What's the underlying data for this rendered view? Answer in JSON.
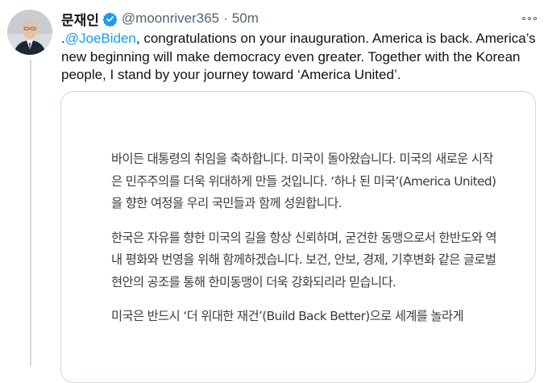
{
  "tweet": {
    "author_name": "문재인",
    "handle": "@moonriver365",
    "separator": "·",
    "time": "50m",
    "text_prefix": ".",
    "mention": "@JoeBiden",
    "text_body": ", congratulations on your inauguration. America is back. America’s new beginning will make democracy even greater. Together with the Korean people, I stand by your journey toward ‘America United’."
  },
  "card": {
    "paragraphs": [
      "바이든 대통령의 취임을 축하합니다. 미국이 돌아왔습니다. 미국의 새로운 시작은 민주주의를 더욱 위대하게 만들 것입니다. ‘하나 된 미국’(America United)을 향한 여정을 우리 국민들과 함께 성원합니다.",
      "한국은 자유를 향한 미국의 길을 항상 신뢰하며, 굳건한 동맹으로서 한반도와 역내 평화와 번영을 위해 함께하겠습니다. 보건, 안보, 경제, 기후변화 같은 글로벌 현안의 공조를 통해 한미동맹이 더욱 강화되리라 믿습니다.",
      "미국은 반드시 ‘더 위대한 재건’(Build Back Better)으로 세계를 놀라게"
    ]
  },
  "colors": {
    "accent": "#1d9bf0",
    "secondary_text": "#536471",
    "border": "#cfd9de"
  },
  "icons": {
    "verified": "verified-badge-icon",
    "more": "more-options-icon"
  }
}
